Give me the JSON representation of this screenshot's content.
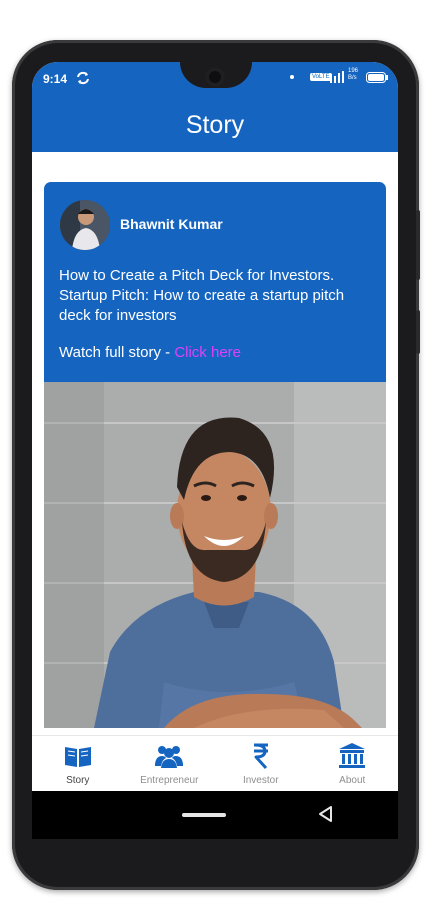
{
  "status_bar": {
    "time": "9:14",
    "network_label": "VoLTE",
    "speed_label": "196\nB/s"
  },
  "app_bar": {
    "title": "Story"
  },
  "story": {
    "author": "Bhawnit Kumar",
    "title": "How to Create a Pitch Deck for Investors. Startup Pitch: How to create a startup pitch deck for investors",
    "watch_prefix": "Watch full story - ",
    "watch_link": "Click here"
  },
  "bottom_nav": {
    "items": [
      {
        "label": "Story",
        "icon": "book-icon",
        "active": true
      },
      {
        "label": "Entrepreneur",
        "icon": "group-icon",
        "active": false
      },
      {
        "label": "Investor",
        "icon": "rupee-icon",
        "active": false
      },
      {
        "label": "About",
        "icon": "bank-icon",
        "active": false
      }
    ]
  },
  "colors": {
    "primary": "#1565c0",
    "link": "#e040fb",
    "phone_body": "#1b1b1d"
  }
}
